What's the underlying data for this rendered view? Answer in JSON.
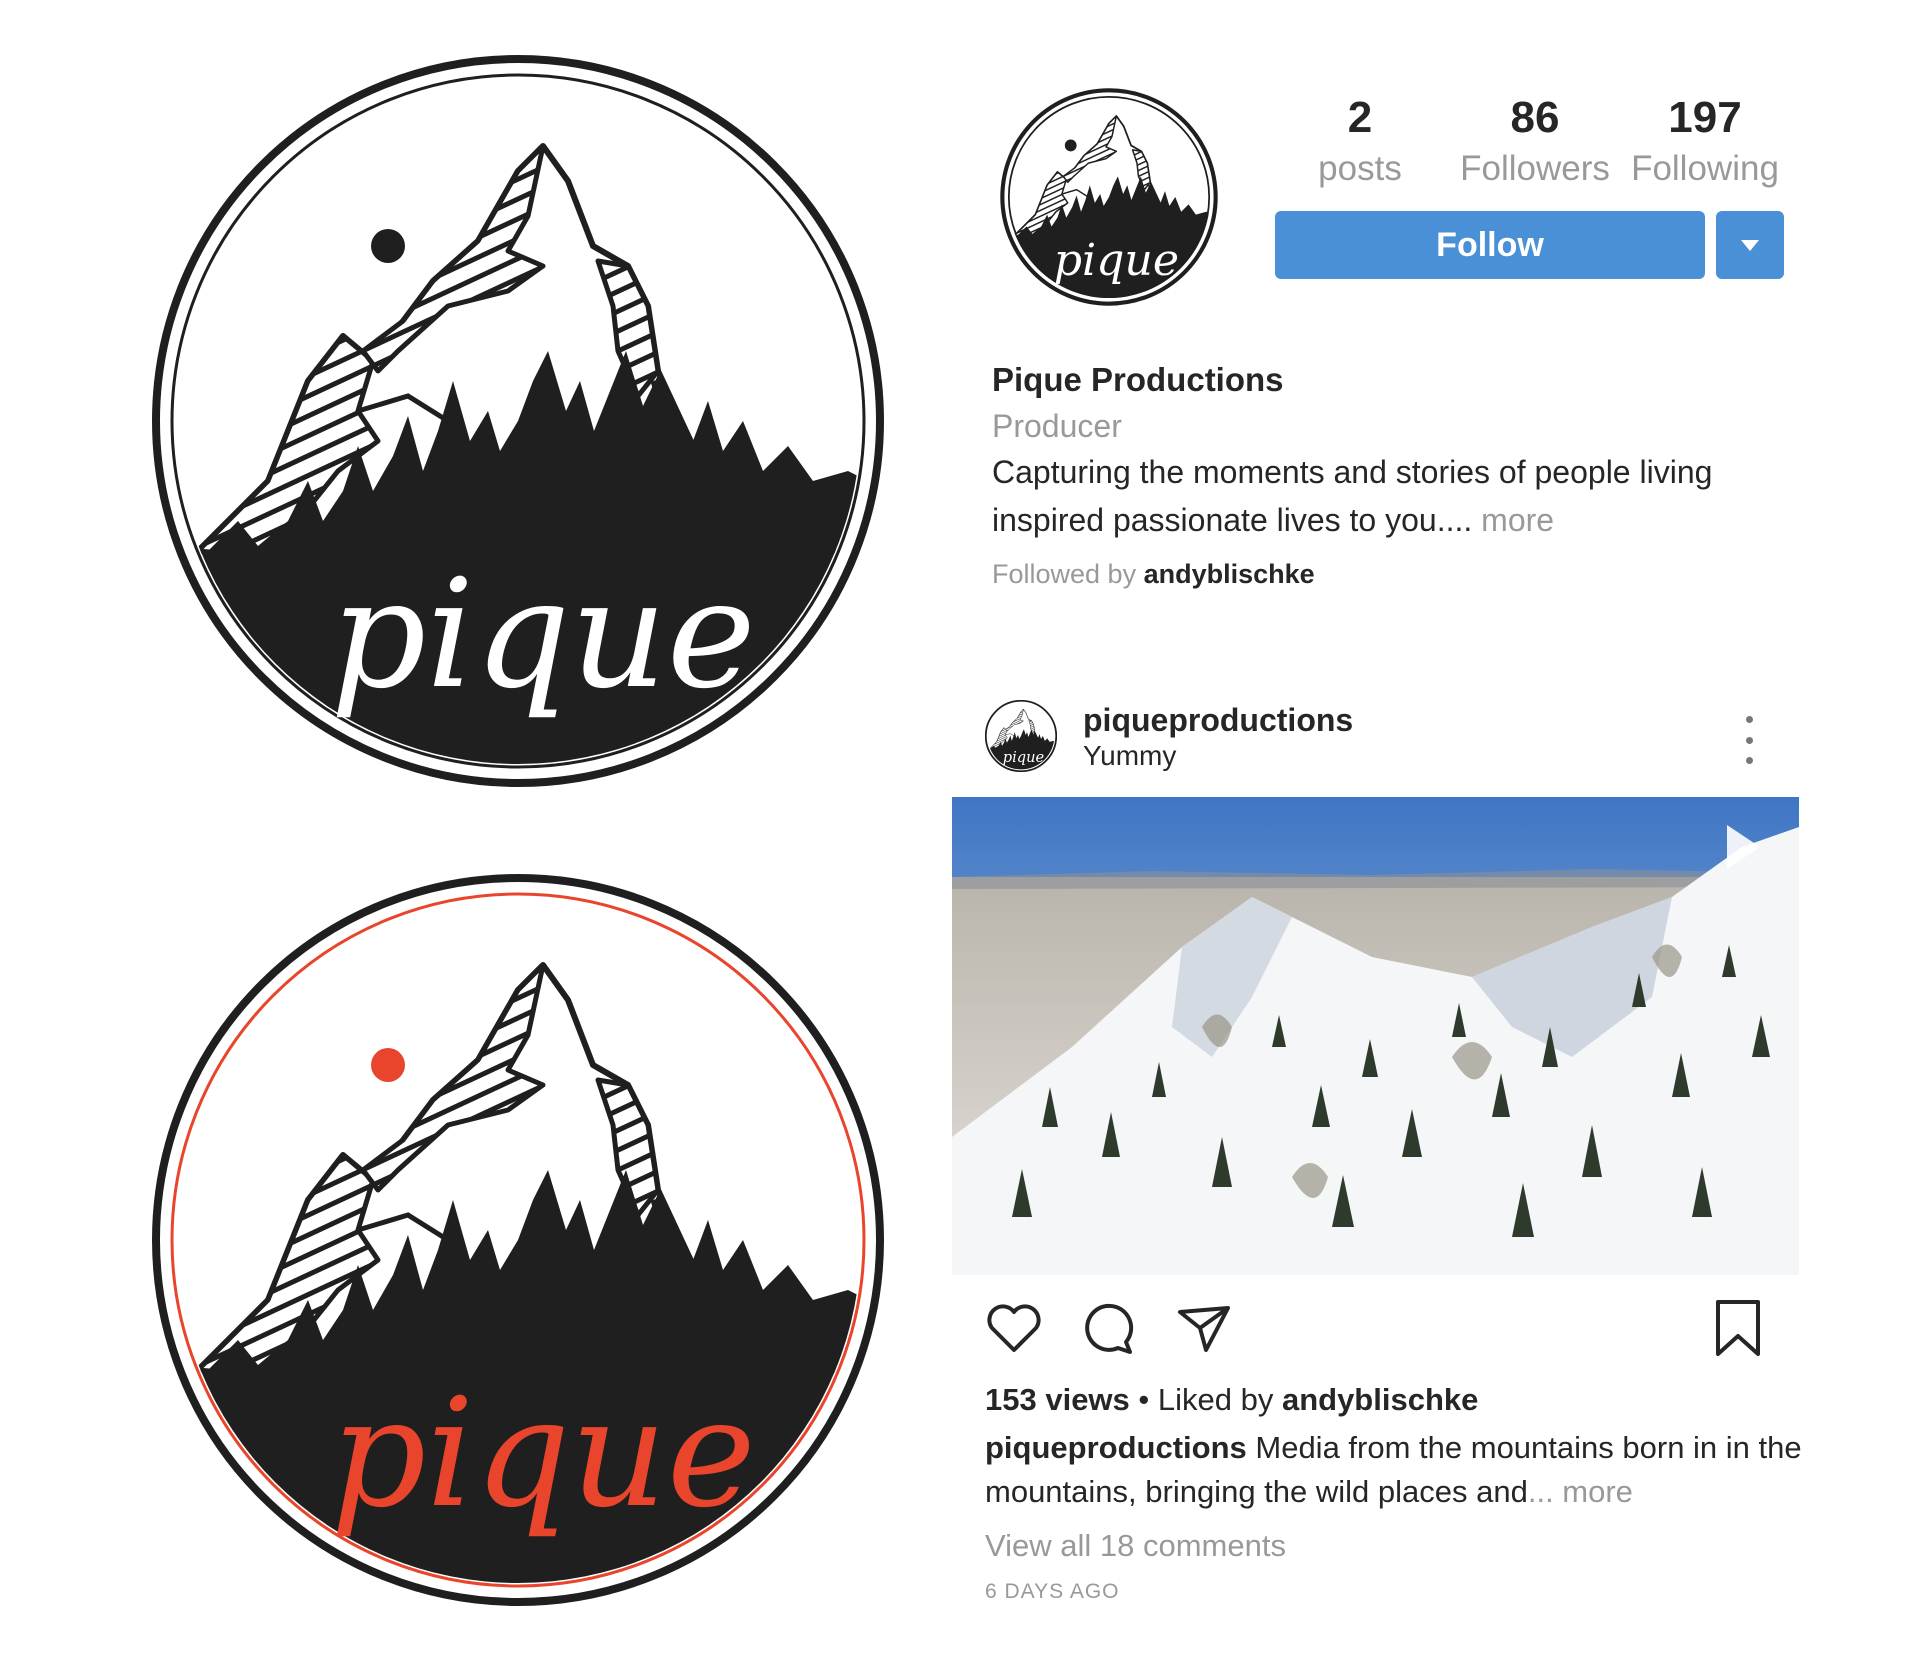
{
  "logos": {
    "mono": {
      "wordmark": "pique",
      "ring_color": "#1f1f1f",
      "sun_color": "#1f1f1f",
      "wordmark_color": "#ffffff"
    },
    "color": {
      "wordmark": "pique",
      "ring_color": "#e8452c",
      "sun_color": "#e8452c",
      "wordmark_color": "#e8452c"
    }
  },
  "profile": {
    "avatar_icon": "pique-logo-avatar",
    "stats": {
      "posts": {
        "value": "2",
        "label": "posts"
      },
      "followers": {
        "value": "86",
        "label": "Followers"
      },
      "following": {
        "value": "197",
        "label": "Following"
      }
    },
    "follow_label": "Follow",
    "dropdown_icon": "caret-down-icon",
    "name": "Pique Productions",
    "category": "Producer",
    "bio_line1": "Capturing the moments and stories of people living",
    "bio_line2": "inspired passionate lives to you.... ",
    "bio_more": "more",
    "followed_by_prefix": "Followed by ",
    "followed_by_user": "andyblischke"
  },
  "post": {
    "username": "piqueproductions",
    "location": "Yummy",
    "media_alt": "Aerial view of snowy mountain ridge with pine trees",
    "play_icon": "play-icon",
    "actions": {
      "like_icon": "heart-icon",
      "comment_icon": "comment-icon",
      "share_icon": "send-icon",
      "save_icon": "bookmark-icon"
    },
    "views": "153 views",
    "liked_by_prefix": " • Liked by ",
    "liked_by_user": "andyblischke",
    "caption_user": "piqueproductions",
    "caption_text": " Media from the mountains born in in the mountains, bringing the wild places and",
    "caption_more": "... more",
    "comments_link": "View all 18 comments",
    "timestamp": "6 DAYS AGO"
  },
  "colors": {
    "accent_blue": "#4a90d6",
    "brand_red": "#e8452c",
    "text_dark": "#262626",
    "text_muted": "#999999"
  }
}
